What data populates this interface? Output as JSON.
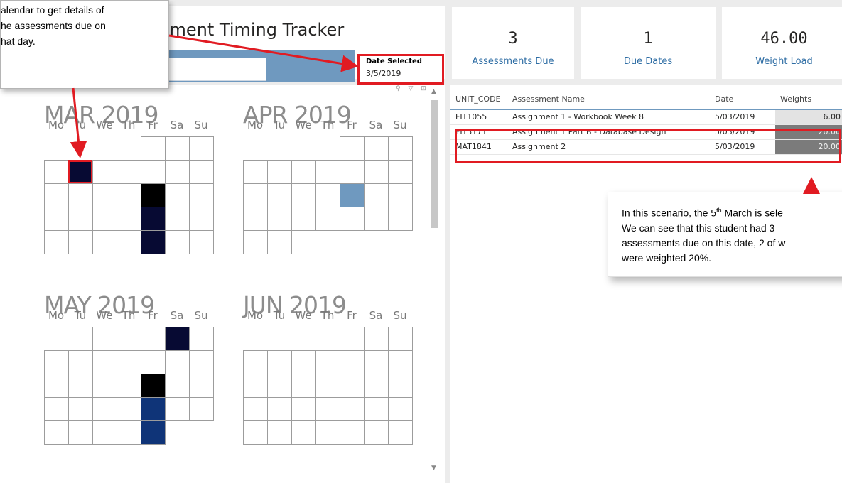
{
  "report": {
    "title": "sment Timing Tracker"
  },
  "slicer": {
    "label": "Date Selected",
    "value": "3/5/2019"
  },
  "kpis": [
    {
      "value": "3",
      "label": "Assessments Due"
    },
    {
      "value": "1",
      "label": "Due Dates"
    },
    {
      "value": "46.00",
      "label": "Weight Load"
    }
  ],
  "calendar": {
    "day_headers": [
      "Mo",
      "Tu",
      "We",
      "Th",
      "Fr",
      "Sa",
      "Su"
    ],
    "months": [
      {
        "name": "MAR 2019"
      },
      {
        "name": "APR 2019"
      },
      {
        "name": "MAY 2019"
      },
      {
        "name": "JUN 2019"
      }
    ],
    "colors": {
      "empty": "#ffffff",
      "dark": "#070a33",
      "black": "#000000",
      "navy": "#0f3478",
      "light_blue": "#6f99bf",
      "selected_outline": "#e11b22"
    }
  },
  "table": {
    "headers": [
      "UNIT_CODE",
      "Assessment Name",
      "Date",
      "Weights"
    ],
    "rows": [
      {
        "unit_code": "FIT1055",
        "name": "Assignment 1 - Workbook Week 8",
        "date": "5/03/2019",
        "weight": "6.00"
      },
      {
        "unit_code": "FIT3171",
        "name": "Assignment 1 Part B - Database Design",
        "date": "5/03/2019",
        "weight": "20.00"
      },
      {
        "unit_code": "MAT1841",
        "name": "Assignment 2",
        "date": "5/03/2019",
        "weight": "20.00"
      }
    ],
    "weight_colors": {
      "low": "#e3e3e3",
      "high": "#7b7b7b"
    }
  },
  "annotations": {
    "top_left": "alendar to get details of\nhe assessments due on\nhat day.",
    "bottom_right_before_sup": "In this scenario, the 5",
    "bottom_right_sup": "th",
    "bottom_right_after_sup": " March is sele\nWe can see that this student had 3\nassessments due on this date, 2 of w\nwere weighted 20%."
  }
}
